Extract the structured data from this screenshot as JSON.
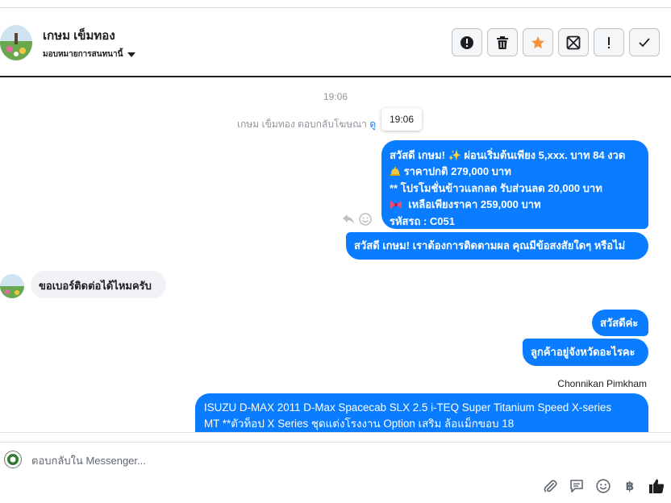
{
  "header": {
    "contact_name": "เกษม เข็มทอง",
    "assign_label": "มอบหมายการสนทนานี้"
  },
  "thread": {
    "timestamp": "19:06",
    "system_text": "เกษม เข็มทอง ตอบกลับโฆษณา",
    "system_link": "ดู",
    "tooltip": "19:06",
    "outgoing_1": {
      "line1": "สวัสดี เกษม! ✨  ผ่อนเริ่มต้นเพียง 5,xxx. บาท 84 งวด",
      "line2": "ราคาปกติ 279,000 บาท",
      "line3": "** โปรโมชั่นข้าวแลกลด รับส่วนลด 20,000 บาท",
      "line4": "เหลือเพียงราคา 259,000 บาท",
      "line5": "รหัสรถ : C051"
    },
    "outgoing_2": "สวัสดี เกษม! เราต้องการติดตามผล คุณมีข้อสงสัยใดๆ หรือไม่",
    "incoming_1": "ขอเบอร์ติดต่อได้ไหมครับ",
    "outgoing_3": "สวัสดีค่ะ",
    "outgoing_4": "ลูกค้าอยู่จังหวัดอะไรคะ",
    "sender_name": "Chonnikan Pimkham",
    "outgoing_5": {
      "line1": "ISUZU D-MAX 2011 D-Max Spacecab SLX 2.5 i-TEQ Super Titanium Speed X-series",
      "line2": "MT **ตัวท็อป X Series ชุดแต่งโรงงาน Option เสริม ล้อแม็กขอบ 18"
    }
  },
  "composer": {
    "placeholder": "ตอบกลับใน Messenger...",
    "currency_symbol": "฿"
  },
  "colors": {
    "accent": "#0a7cff",
    "star": "#f7923a",
    "incoming_bg": "#f0f2f5"
  },
  "icons": {
    "actions": [
      "alert-circle-icon",
      "trash-icon",
      "star-icon",
      "archive-icon",
      "exclamation-icon",
      "check-icon"
    ],
    "composer": [
      "paperclip-icon",
      "chat-icon",
      "smiley-icon",
      "baht-icon",
      "thumbs-up-icon"
    ]
  }
}
